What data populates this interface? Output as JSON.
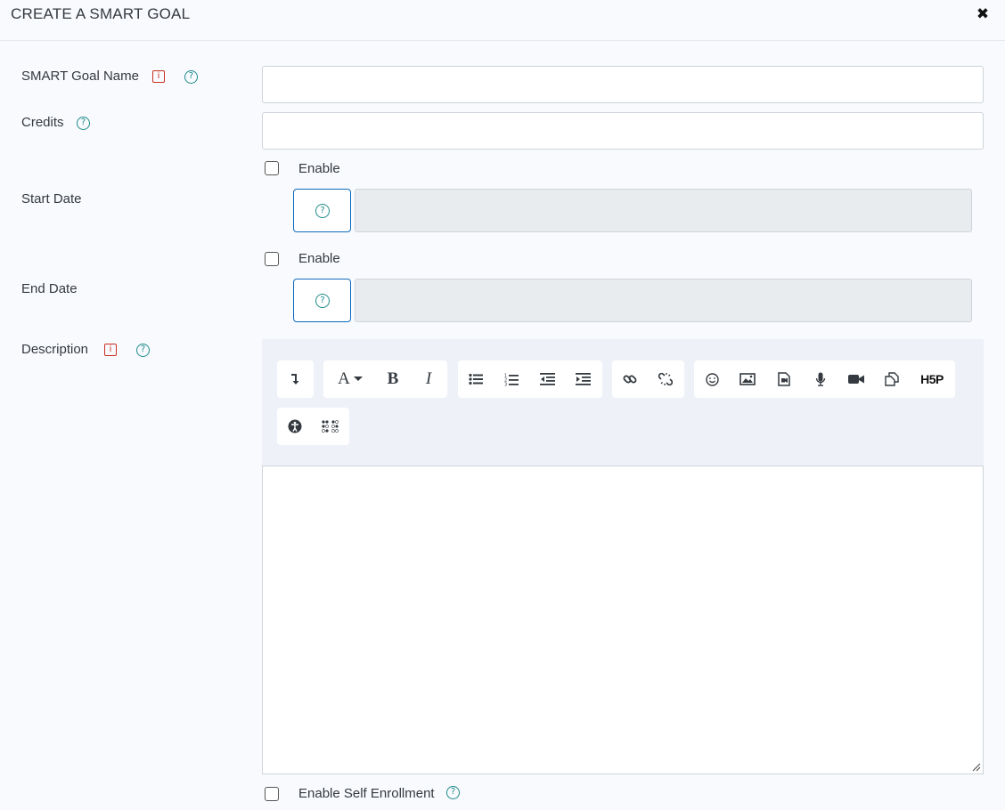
{
  "modal": {
    "title": "CREATE A SMART GOAL",
    "close_symbol": "✖"
  },
  "fields": {
    "goal_name": {
      "label": "SMART Goal Name",
      "value": "",
      "placeholder": ""
    },
    "credits": {
      "label": "Credits",
      "value": "",
      "placeholder": ""
    },
    "start_date": {
      "label": "Start Date",
      "enable_label": "Enable",
      "enabled": false
    },
    "end_date": {
      "label": "End Date",
      "enable_label": "Enable",
      "enabled": false
    },
    "description": {
      "label": "Description"
    },
    "self_enrollment": {
      "label": "Enable Self Enrollment",
      "enabled": false
    }
  },
  "icons": {
    "required": "required-icon",
    "help": "help-icon",
    "required_glyph": "i",
    "help_glyph": "?"
  },
  "toolbar": {
    "font_glyph": "A",
    "bold_glyph": "B",
    "italic_glyph": "I",
    "h5p_label": "H5P",
    "buttons": [
      "collapse",
      "font-color",
      "bold",
      "italic",
      "unordered-list",
      "ordered-list",
      "outdent",
      "indent",
      "link",
      "unlink",
      "emoji",
      "image",
      "media",
      "record-audio",
      "record-video",
      "manage-files",
      "h5p",
      "accessibility-checker",
      "screenreader-helper"
    ]
  },
  "colors": {
    "required": "#ca3120",
    "help": "#1f8a8a",
    "primary_border": "#0f6cbf",
    "toolbar_bg": "#eef2f8",
    "disabled_field": "#e9ecef"
  }
}
